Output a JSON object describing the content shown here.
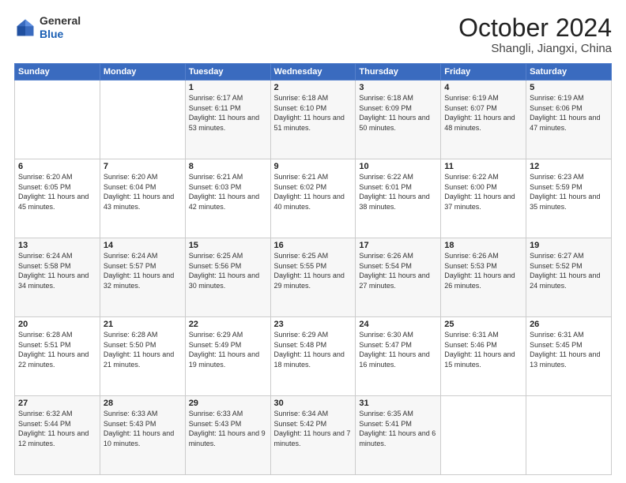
{
  "header": {
    "logo_general": "General",
    "logo_blue": "Blue",
    "month": "October 2024",
    "location": "Shangli, Jiangxi, China"
  },
  "days_of_week": [
    "Sunday",
    "Monday",
    "Tuesday",
    "Wednesday",
    "Thursday",
    "Friday",
    "Saturday"
  ],
  "weeks": [
    [
      {
        "day": "",
        "info": ""
      },
      {
        "day": "",
        "info": ""
      },
      {
        "day": "1",
        "sunrise": "6:17 AM",
        "sunset": "6:11 PM",
        "daylight": "11 hours and 53 minutes."
      },
      {
        "day": "2",
        "sunrise": "6:18 AM",
        "sunset": "6:10 PM",
        "daylight": "11 hours and 51 minutes."
      },
      {
        "day": "3",
        "sunrise": "6:18 AM",
        "sunset": "6:09 PM",
        "daylight": "11 hours and 50 minutes."
      },
      {
        "day": "4",
        "sunrise": "6:19 AM",
        "sunset": "6:07 PM",
        "daylight": "11 hours and 48 minutes."
      },
      {
        "day": "5",
        "sunrise": "6:19 AM",
        "sunset": "6:06 PM",
        "daylight": "11 hours and 47 minutes."
      }
    ],
    [
      {
        "day": "6",
        "sunrise": "6:20 AM",
        "sunset": "6:05 PM",
        "daylight": "11 hours and 45 minutes."
      },
      {
        "day": "7",
        "sunrise": "6:20 AM",
        "sunset": "6:04 PM",
        "daylight": "11 hours and 43 minutes."
      },
      {
        "day": "8",
        "sunrise": "6:21 AM",
        "sunset": "6:03 PM",
        "daylight": "11 hours and 42 minutes."
      },
      {
        "day": "9",
        "sunrise": "6:21 AM",
        "sunset": "6:02 PM",
        "daylight": "11 hours and 40 minutes."
      },
      {
        "day": "10",
        "sunrise": "6:22 AM",
        "sunset": "6:01 PM",
        "daylight": "11 hours and 38 minutes."
      },
      {
        "day": "11",
        "sunrise": "6:22 AM",
        "sunset": "6:00 PM",
        "daylight": "11 hours and 37 minutes."
      },
      {
        "day": "12",
        "sunrise": "6:23 AM",
        "sunset": "5:59 PM",
        "daylight": "11 hours and 35 minutes."
      }
    ],
    [
      {
        "day": "13",
        "sunrise": "6:24 AM",
        "sunset": "5:58 PM",
        "daylight": "11 hours and 34 minutes."
      },
      {
        "day": "14",
        "sunrise": "6:24 AM",
        "sunset": "5:57 PM",
        "daylight": "11 hours and 32 minutes."
      },
      {
        "day": "15",
        "sunrise": "6:25 AM",
        "sunset": "5:56 PM",
        "daylight": "11 hours and 30 minutes."
      },
      {
        "day": "16",
        "sunrise": "6:25 AM",
        "sunset": "5:55 PM",
        "daylight": "11 hours and 29 minutes."
      },
      {
        "day": "17",
        "sunrise": "6:26 AM",
        "sunset": "5:54 PM",
        "daylight": "11 hours and 27 minutes."
      },
      {
        "day": "18",
        "sunrise": "6:26 AM",
        "sunset": "5:53 PM",
        "daylight": "11 hours and 26 minutes."
      },
      {
        "day": "19",
        "sunrise": "6:27 AM",
        "sunset": "5:52 PM",
        "daylight": "11 hours and 24 minutes."
      }
    ],
    [
      {
        "day": "20",
        "sunrise": "6:28 AM",
        "sunset": "5:51 PM",
        "daylight": "11 hours and 22 minutes."
      },
      {
        "day": "21",
        "sunrise": "6:28 AM",
        "sunset": "5:50 PM",
        "daylight": "11 hours and 21 minutes."
      },
      {
        "day": "22",
        "sunrise": "6:29 AM",
        "sunset": "5:49 PM",
        "daylight": "11 hours and 19 minutes."
      },
      {
        "day": "23",
        "sunrise": "6:29 AM",
        "sunset": "5:48 PM",
        "daylight": "11 hours and 18 minutes."
      },
      {
        "day": "24",
        "sunrise": "6:30 AM",
        "sunset": "5:47 PM",
        "daylight": "11 hours and 16 minutes."
      },
      {
        "day": "25",
        "sunrise": "6:31 AM",
        "sunset": "5:46 PM",
        "daylight": "11 hours and 15 minutes."
      },
      {
        "day": "26",
        "sunrise": "6:31 AM",
        "sunset": "5:45 PM",
        "daylight": "11 hours and 13 minutes."
      }
    ],
    [
      {
        "day": "27",
        "sunrise": "6:32 AM",
        "sunset": "5:44 PM",
        "daylight": "11 hours and 12 minutes."
      },
      {
        "day": "28",
        "sunrise": "6:33 AM",
        "sunset": "5:43 PM",
        "daylight": "11 hours and 10 minutes."
      },
      {
        "day": "29",
        "sunrise": "6:33 AM",
        "sunset": "5:43 PM",
        "daylight": "11 hours and 9 minutes."
      },
      {
        "day": "30",
        "sunrise": "6:34 AM",
        "sunset": "5:42 PM",
        "daylight": "11 hours and 7 minutes."
      },
      {
        "day": "31",
        "sunrise": "6:35 AM",
        "sunset": "5:41 PM",
        "daylight": "11 hours and 6 minutes."
      },
      {
        "day": "",
        "info": ""
      },
      {
        "day": "",
        "info": ""
      }
    ]
  ]
}
